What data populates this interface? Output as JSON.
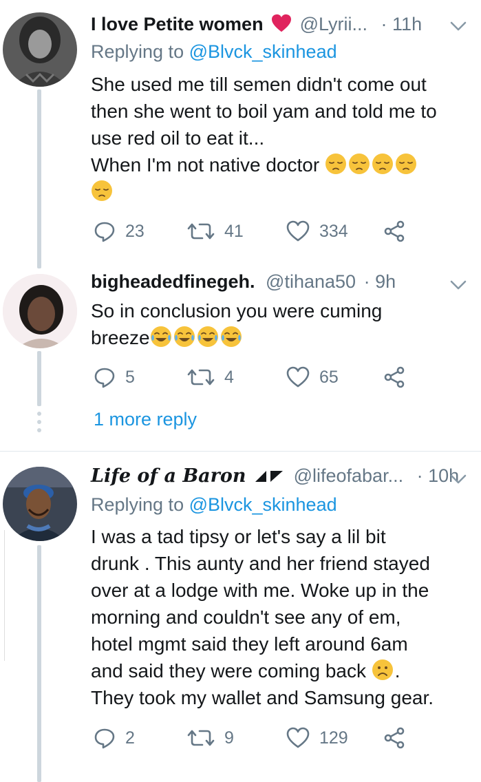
{
  "tweets": [
    {
      "name": "I love Petite women",
      "handle": "@Lyrii...",
      "time": "· 11h",
      "replying_prefix": "Replying to ",
      "replying_to": "@Blvck_skinhead",
      "text_lines": [
        "She used me till semen didn't come out",
        "then she went to boil yam and told me to",
        "use red oil to eat it...",
        "When I'm not native doctor"
      ],
      "replies": "23",
      "retweets": "41",
      "likes": "334"
    },
    {
      "name": "bigheadedfinegeh.",
      "handle": "@tihana50",
      "time": "· 9h",
      "text_lines": [
        "So in conclusion you were cuming",
        "breeze"
      ],
      "replies": "5",
      "retweets": "4",
      "likes": "65"
    },
    {
      "name": "Life of a Baron",
      "handle": "@lifeofabar...",
      "time": "· 10h",
      "replying_prefix": "Replying to ",
      "replying_to": "@Blvck_skinhead",
      "text_lines": [
        "I was a tad tipsy or let's say a lil bit",
        "drunk . This aunty and her friend stayed",
        "over at a lodge with me. Woke up in the",
        "morning and couldn't see any of em,",
        "hotel mgmt said they left around 6am",
        "and said they were coming back",
        "They took my wallet and Samsung gear."
      ],
      "replies": "2",
      "retweets": "9",
      "likes": "129"
    }
  ],
  "more_reply": "1 more reply",
  "colors": {
    "link": "#1b95e0",
    "muted": "#657786",
    "text": "#14171a",
    "heart": "#e0245e",
    "emoji": "#f7c33b"
  },
  "icons": [
    "reply-icon",
    "retweet-icon",
    "like-icon",
    "share-icon",
    "chevron-down-icon",
    "heart-emoji",
    "pensive-emoji",
    "tears-of-joy-emoji",
    "frowning-emoji",
    "play-triangle-icon"
  ]
}
